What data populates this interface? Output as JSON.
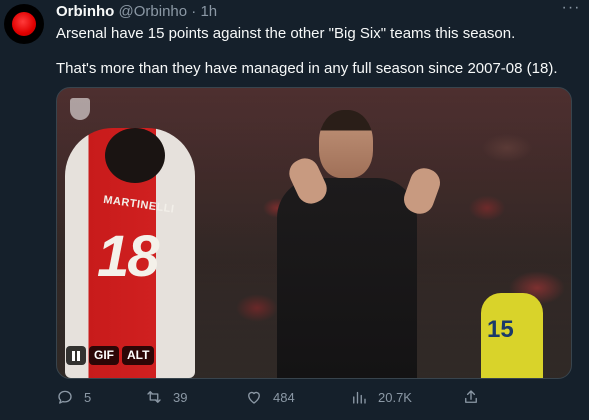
{
  "tweet": {
    "author_name": "Orbinho",
    "author_handle": "@Orbinho",
    "separator": "·",
    "time": "1h",
    "more_label": "···",
    "text_line1": "Arsenal have 15 points against the other \"Big Six\" teams this season.",
    "text_line2": "That's more than they have managed in any full season since 2007-08 (18)."
  },
  "media": {
    "type": "gif",
    "shirt_name": "MARTINELLI",
    "shirt_number": "18",
    "other_shirt_number": "15",
    "badges": {
      "gif": "GIF",
      "alt": "ALT"
    },
    "pause_icon": "pause-icon"
  },
  "actions": {
    "reply_count": "5",
    "retweet_count": "39",
    "like_count": "484",
    "view_count": "20.7K"
  },
  "icons": [
    "reply-icon",
    "retweet-icon",
    "like-icon",
    "views-icon",
    "share-icon"
  ],
  "colors": {
    "background": "#15202b",
    "text_primary": "#f7f9f9",
    "text_secondary": "#8b98a5",
    "avatar_red": "#e00000"
  }
}
